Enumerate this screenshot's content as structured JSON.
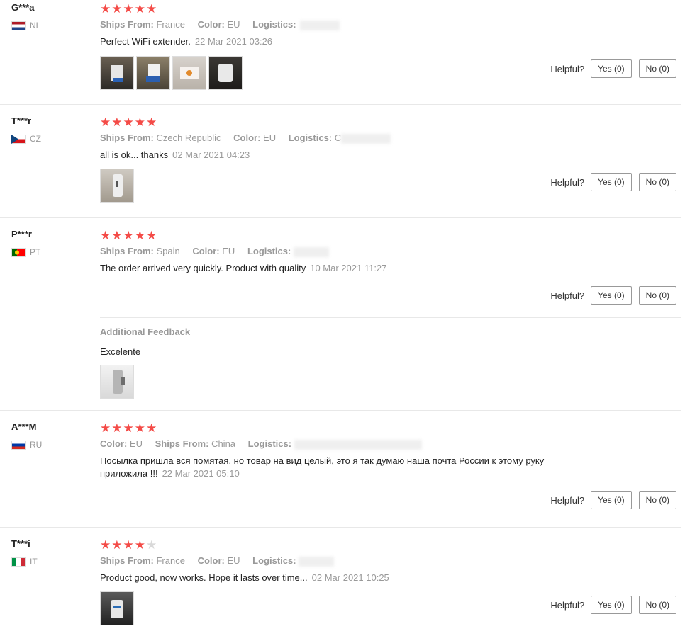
{
  "labels": {
    "ships_from": "Ships From:",
    "color": "Color:",
    "logistics": "Logistics:",
    "helpful": "Helpful?",
    "yes": "Yes (0)",
    "no": "No (0)",
    "additional_feedback": "Additional Feedback"
  },
  "colors": {
    "star": "#f44b47",
    "star_empty": "#d9d9d9",
    "muted": "#999999"
  },
  "reviews": [
    {
      "user": "G***a",
      "country": "NL",
      "stars": 5,
      "ships_from": "France",
      "color": "EU",
      "text": "Perfect WiFi extender.",
      "date": "22 Mar 2021 03:26",
      "photos": 4
    },
    {
      "user": "T***r",
      "country": "CZ",
      "stars": 5,
      "ships_from": "Czech Republic",
      "color": "EU",
      "logistics_partial": "C",
      "text": "all is ok... thanks",
      "date": "02 Mar 2021 04:23",
      "photos": 1
    },
    {
      "user": "P***r",
      "country": "PT",
      "stars": 5,
      "ships_from": "Spain",
      "color": "EU",
      "text": "The order arrived very quickly. Product with quality",
      "date": "10 Mar 2021 11:27",
      "photos": 0,
      "additional": {
        "text": "Excelente",
        "photos": 1
      }
    },
    {
      "user": "A***M",
      "country": "RU",
      "stars": 5,
      "color": "EU",
      "ships_from": "China",
      "text": "Посылка пришла вся помятая, но товар на вид целый, это я так думаю наша почта России к этому руку приложила !!!",
      "date": "22 Mar 2021 05:10",
      "photos": 0
    },
    {
      "user": "T***i",
      "country": "IT",
      "stars": 4,
      "ships_from": "France",
      "color": "EU",
      "text": "Product good, now works. Hope it lasts over time...",
      "date": "02 Mar 2021 10:25",
      "photos": 1
    }
  ]
}
